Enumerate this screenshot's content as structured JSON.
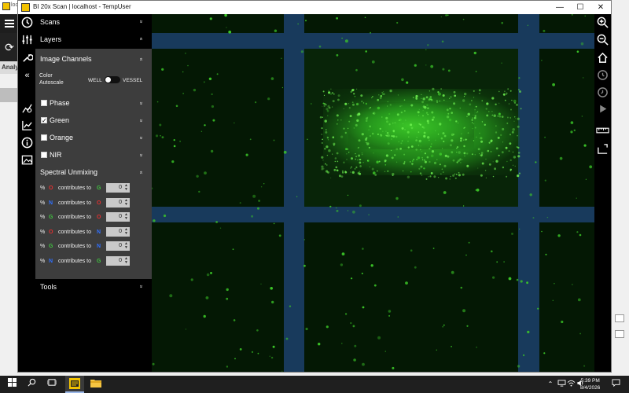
{
  "background_app": {
    "title": "local",
    "tab_label": "Analy"
  },
  "window": {
    "title": "BI 20x Scan | localhost - TempUser",
    "minimize_glyph": "—",
    "maximize_glyph": "☐",
    "close_glyph": "✕"
  },
  "left_strip": {
    "collapse_glyph": "«"
  },
  "panel": {
    "scans_label": "Scans",
    "layers_label": "Layers",
    "image_channels_label": "Image Channels",
    "color_autoscale_label": "Color Autoscale",
    "toggle_left_label": "WELL",
    "toggle_right_label": "VESSEL",
    "channels": [
      {
        "label": "Phase",
        "checked": false
      },
      {
        "label": "Green",
        "checked": true
      },
      {
        "label": "Orange",
        "checked": false
      },
      {
        "label": "NIR",
        "checked": false
      }
    ],
    "spectral_label": "Spectral Unmixing",
    "mix_rows": [
      {
        "pct": "%",
        "src": "O",
        "src_color": "#e03030",
        "text": "contributes to",
        "dst": "G",
        "dst_color": "#40c040",
        "value": "0"
      },
      {
        "pct": "%",
        "src": "N",
        "src_color": "#3070ff",
        "text": "contributes to",
        "dst": "O",
        "dst_color": "#e03030",
        "value": "0"
      },
      {
        "pct": "%",
        "src": "G",
        "src_color": "#40c040",
        "text": "contributes to",
        "dst": "O",
        "dst_color": "#e03030",
        "value": "0"
      },
      {
        "pct": "%",
        "src": "O",
        "src_color": "#e03030",
        "text": "contributes to",
        "dst": "N",
        "dst_color": "#3070ff",
        "value": "0"
      },
      {
        "pct": "%",
        "src": "G",
        "src_color": "#40c040",
        "text": "contributes to",
        "dst": "N",
        "dst_color": "#3070ff",
        "value": "0"
      },
      {
        "pct": "%",
        "src": "N",
        "src_color": "#3070ff",
        "text": "contributes to",
        "dst": "G",
        "dst_color": "#40c040",
        "value": "0"
      }
    ],
    "tools_label": "Tools",
    "chevron_down": "»",
    "chevron_up": "«"
  },
  "taskbar": {
    "time": "5:39 PM",
    "date": "8/4/2026"
  },
  "colors": {
    "panel_gray": "#3d3d3d",
    "grid_band": "#183a5c",
    "fluorescence": "#3cc828"
  }
}
